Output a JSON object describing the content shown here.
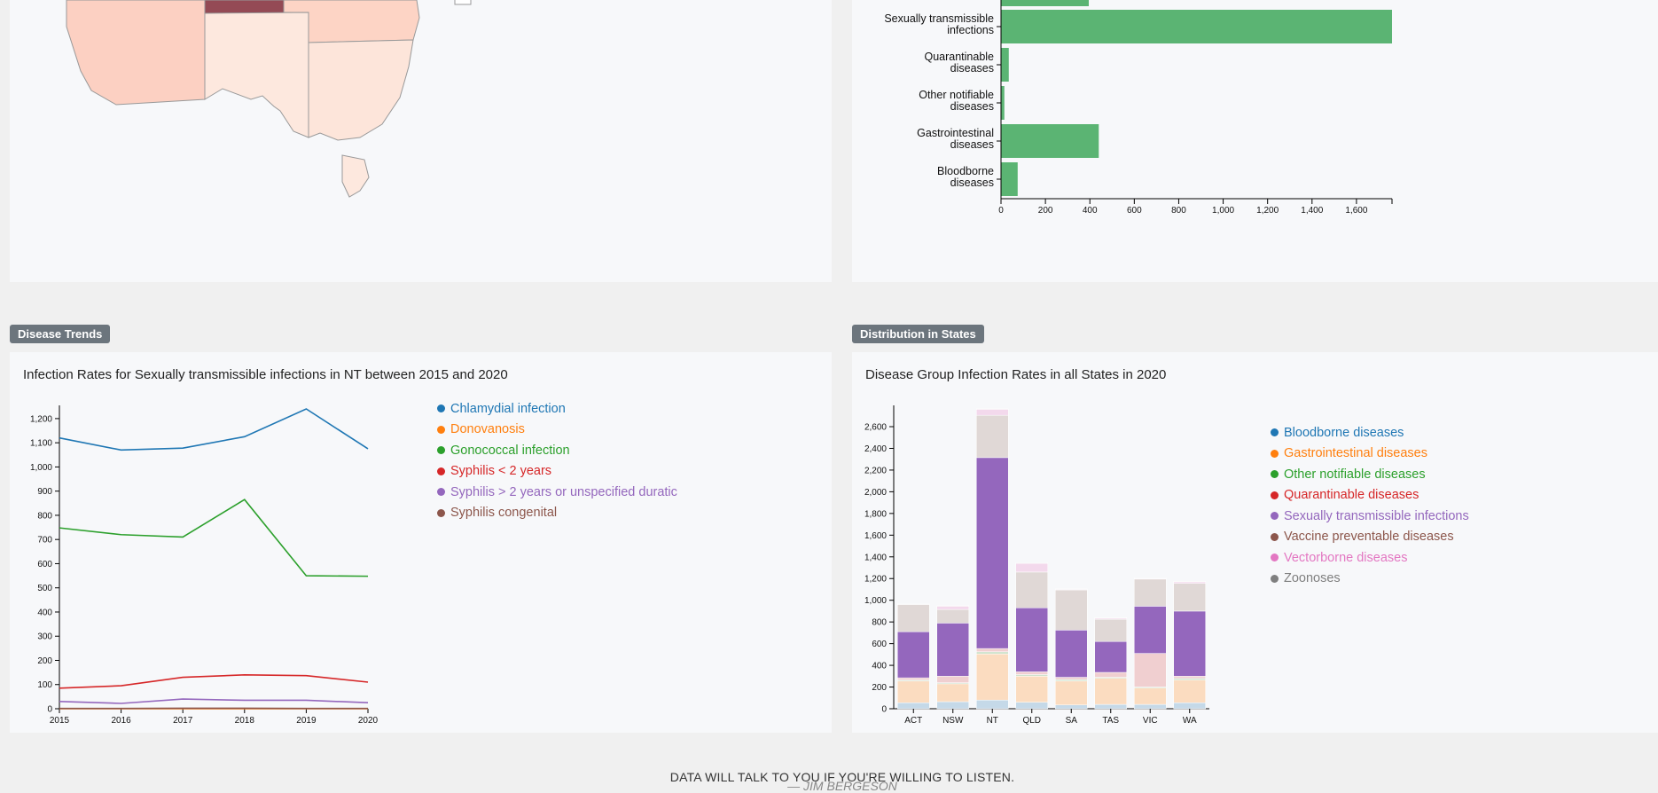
{
  "sections": {
    "trends_badge": "Disease Trends",
    "distribution_badge": "Distribution in States"
  },
  "footer": {
    "quote": "DATA WILL TALK TO YOU IF YOU'RE WILLING TO LISTEN.",
    "author": "— JIM BERGESON"
  },
  "colors": {
    "blue": "#1f77b4",
    "orange": "#ff7f0e",
    "green": "#2ca02c",
    "red": "#d62728",
    "purple": "#9467bd",
    "brown": "#8c564b",
    "pink": "#e377c2",
    "gray": "#7f7f7f",
    "bar_green": "#5bb473"
  },
  "chart_data": [
    {
      "type": "bar",
      "orientation": "horizontal",
      "title": "",
      "categories": [
        "Sexually transmissible infections",
        "Quarantinable diseases",
        "Other notifiable diseases",
        "Gastrointestinal diseases",
        "Bloodborne diseases"
      ],
      "category_lines": [
        [
          "Sexually transmissible",
          "infections"
        ],
        [
          "Quarantinable",
          "diseases"
        ],
        [
          "Other notifiable",
          "diseases"
        ],
        [
          "Gastrointestinal",
          "diseases"
        ],
        [
          "Bloodborne",
          "diseases"
        ]
      ],
      "values": [
        1760,
        35,
        15,
        440,
        75
      ],
      "partial_top_value": 395,
      "xlim": [
        0,
        1760
      ],
      "xticks": [
        0,
        200,
        400,
        600,
        800,
        1000,
        1200,
        1400,
        1600
      ],
      "xtick_labels": [
        "0",
        "200",
        "400",
        "600",
        "800",
        "1,000",
        "1,200",
        "1,400",
        "1,600"
      ]
    },
    {
      "type": "line",
      "title": "Infection Rates for Sexually transmissible infections in NT between 2015 and 2020",
      "x": [
        2015,
        2016,
        2017,
        2018,
        2019,
        2020
      ],
      "ylim": [
        0,
        1240
      ],
      "yticks": [
        0,
        100,
        200,
        300,
        400,
        500,
        600,
        700,
        800,
        900,
        1000,
        1100,
        1200
      ],
      "ytick_labels": [
        "0",
        "100",
        "200",
        "300",
        "400",
        "500",
        "600",
        "700",
        "800",
        "900",
        "1,000",
        "1,100",
        "1,200"
      ],
      "series": [
        {
          "name": "Chlamydial infection",
          "color": "#1f77b4",
          "values": [
            1120,
            1070,
            1078,
            1125,
            1240,
            1075
          ]
        },
        {
          "name": "Donovanosis",
          "color": "#ff7f0e",
          "values": [
            0,
            0,
            0,
            0,
            0,
            0
          ]
        },
        {
          "name": "Gonococcal infection",
          "color": "#2ca02c",
          "values": [
            748,
            720,
            710,
            865,
            550,
            548
          ]
        },
        {
          "name": "Syphilis < 2 years",
          "color": "#d62728",
          "values": [
            85,
            95,
            130,
            140,
            137,
            110
          ]
        },
        {
          "name": "Syphilis > 2 years or unspecified duratic",
          "color": "#9467bd",
          "values": [
            30,
            22,
            40,
            35,
            35,
            25
          ]
        },
        {
          "name": "Syphilis congenital",
          "color": "#8c564b",
          "values": [
            1,
            1,
            2,
            2,
            1,
            1
          ]
        }
      ]
    },
    {
      "type": "bar",
      "stacked": true,
      "title": "Disease Group Infection Rates in all States in 2020",
      "categories": [
        "ACT",
        "NSW",
        "NT",
        "QLD",
        "SA",
        "TAS",
        "VIC",
        "WA"
      ],
      "ylim": [
        0,
        2780
      ],
      "yticks": [
        0,
        200,
        400,
        600,
        800,
        1000,
        1200,
        1400,
        1600,
        1800,
        2000,
        2200,
        2400,
        2600
      ],
      "ytick_labels": [
        "0",
        "200",
        "400",
        "600",
        "800",
        "1,000",
        "1,200",
        "1,400",
        "1,600",
        "1,800",
        "2,000",
        "2,200",
        "2,400",
        "2,600"
      ],
      "series": [
        {
          "name": "Bloodborne diseases",
          "color": "#1f77b4",
          "fill": "#c5d9e8",
          "values": [
            55,
            65,
            80,
            60,
            35,
            40,
            40,
            55
          ]
        },
        {
          "name": "Gastrointestinal diseases",
          "color": "#ff7f0e",
          "fill": "#fbdcc0",
          "values": [
            200,
            165,
            425,
            240,
            220,
            240,
            150,
            210
          ]
        },
        {
          "name": "Other notifiable diseases",
          "color": "#2ca02c",
          "fill": "#cfe3cd",
          "values": [
            10,
            10,
            20,
            15,
            15,
            10,
            10,
            15
          ]
        },
        {
          "name": "Quarantinable diseases",
          "color": "#d62728",
          "fill": "#f0cfd0",
          "values": [
            20,
            60,
            30,
            25,
            20,
            45,
            310,
            20
          ]
        },
        {
          "name": "Sexually transmissible infections",
          "color": "#9467bd",
          "fill": "#9467bd",
          "values": [
            425,
            490,
            1760,
            590,
            435,
            285,
            435,
            600
          ]
        },
        {
          "name": "Vaccine preventable diseases",
          "color": "#8c564b",
          "fill": "#e0d8d6",
          "values": [
            250,
            125,
            390,
            330,
            370,
            205,
            250,
            255
          ]
        },
        {
          "name": "Vectorborne diseases",
          "color": "#e377c2",
          "fill": "#f3d9ec",
          "values": [
            0,
            30,
            55,
            80,
            5,
            10,
            5,
            15
          ]
        },
        {
          "name": "Zoonoses",
          "color": "#7f7f7f",
          "fill": "#d9d9d9",
          "values": [
            5,
            5,
            5,
            5,
            5,
            5,
            5,
            5
          ]
        }
      ]
    }
  ]
}
